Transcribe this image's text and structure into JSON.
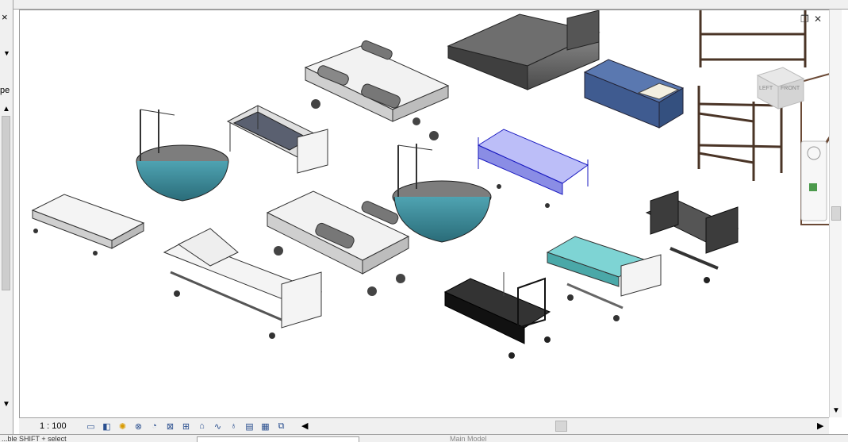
{
  "view": {
    "scale": "1 : 100",
    "icons": [
      "detail-level-icon",
      "visual-style-icon",
      "sun-path-icon",
      "shadows-icon",
      "render-icon",
      "crop-view-icon",
      "show-crop-icon",
      "lock-3d-icon",
      "temporary-hide-icon",
      "reveal-hidden-icon",
      "worksharing-icon",
      "design-options-icon",
      "analytical-model-icon"
    ]
  },
  "left_panel": {
    "label": "pe"
  },
  "status_bar": {
    "hint": "...ble SHIFT + select",
    "model_placeholder": "Main Model"
  },
  "viewcube": {
    "left_label": "LEFT",
    "front_label": "FRONT"
  },
  "colors": {
    "bed_teal": "#3e8a9a",
    "bed_blue": "#2a2fd0",
    "bed_gray": "#6b6b6b",
    "bunk_brown": "#6b4a36"
  }
}
